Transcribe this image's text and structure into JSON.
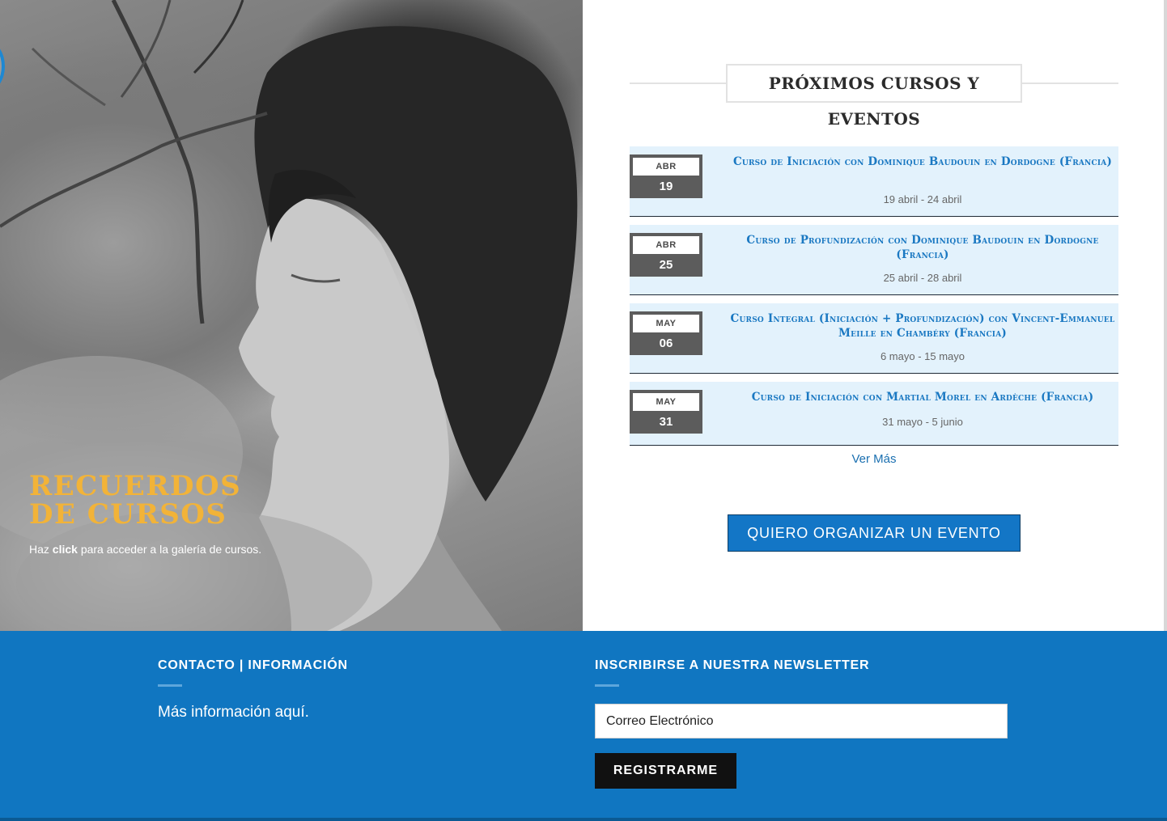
{
  "hero": {
    "title_line1": "Recuerdos",
    "title_line2": "de cursos",
    "caption_pre": "Haz ",
    "caption_bold": "click",
    "caption_post": " para acceder a la galería de cursos."
  },
  "events": {
    "heading": "PRÓXIMOS CURSOS Y EVENTOS",
    "items": [
      {
        "month": "ABR",
        "day": "19",
        "title": "Curso de Iniciación con Dominique Baudouin en Dordogne (Francia)",
        "range": "19 abril - 24 abril"
      },
      {
        "month": "ABR",
        "day": "25",
        "title": "Curso de Profundización con Dominique Baudouin en Dordogne (Francia)",
        "range": "25 abril - 28 abril"
      },
      {
        "month": "MAY",
        "day": "06",
        "title": "Curso Integral (Iniciación + Profundización) con Vincent-Emmanuel Meille en Chambéry (Francia)",
        "range": "6 mayo - 15 mayo"
      },
      {
        "month": "MAY",
        "day": "31",
        "title": "Curso de Iniciación con Martial Morel en Ardèche (Francia)",
        "range": "31 mayo - 5 junio"
      }
    ],
    "more_link": "Ver Más",
    "organize_button": "QUIERO ORGANIZAR UN EVENTO"
  },
  "footer": {
    "contact_title": "CONTACTO | INFORMACIÓN",
    "contact_text": "Más información aquí.",
    "newsletter_title": "INSCRIBIRSE A NUESTRA NEWSLETTER",
    "email_placeholder": "Correo Electrónico",
    "register_button": "REGISTRARME"
  },
  "colors": {
    "accent_blue": "#1076c1",
    "event_bg": "#e3f2fc",
    "event_title": "#1a78c2",
    "hero_title": "#f2b338"
  }
}
